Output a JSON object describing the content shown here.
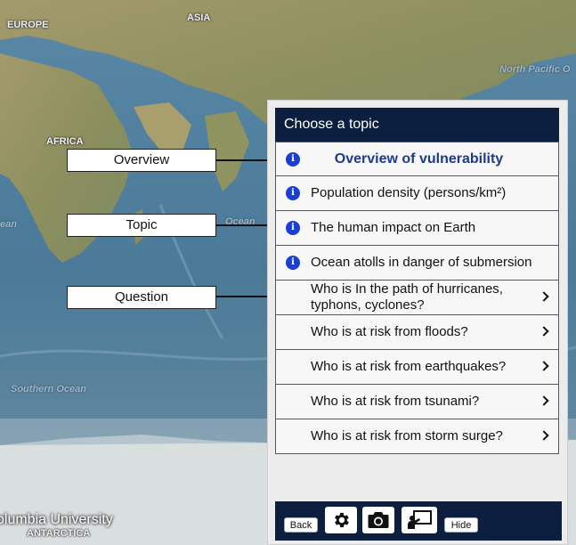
{
  "map": {
    "continent_labels": [
      "EUROPE",
      "ASIA",
      "AFRICA",
      "ANTARCTICA"
    ],
    "ocean_labels": [
      "North Pacific O",
      "Ocean",
      "ean",
      "Southern Ocean"
    ],
    "credit": "olumbia University"
  },
  "callouts": [
    "Overview",
    "Topic",
    "Question"
  ],
  "panel": {
    "header": "Choose a topic",
    "rows": [
      {
        "label": "Overview of vulnerability",
        "icon": "info-icon",
        "featured": true
      },
      {
        "label": "Population density (persons/km²)",
        "icon": "info-icon"
      },
      {
        "label": "The human impact on Earth",
        "icon": "info-icon"
      },
      {
        "label": "Ocean atolls in danger of submersion",
        "icon": "info-icon"
      },
      {
        "label": "Who is In the path of hurricanes, typhons, cyclones?",
        "icon": "chevron-right-icon"
      },
      {
        "label": "Who is at risk from floods?",
        "icon": "chevron-right-icon"
      },
      {
        "label": "Who is at risk from earthquakes?",
        "icon": "chevron-right-icon"
      },
      {
        "label": "Who is at risk from tsunami?",
        "icon": "chevron-right-icon"
      },
      {
        "label": "Who is at risk from storm surge?",
        "icon": "chevron-right-icon"
      }
    ]
  },
  "toolbar": {
    "back_label": "Back",
    "hide_label": "Hide",
    "icons": [
      "gear-icon",
      "camera-icon",
      "presenter-icon"
    ]
  },
  "colors": {
    "panel_header": "#0c1f3e",
    "info_icon": "#1a3fd0",
    "featured_text": "#1d3b8a"
  }
}
